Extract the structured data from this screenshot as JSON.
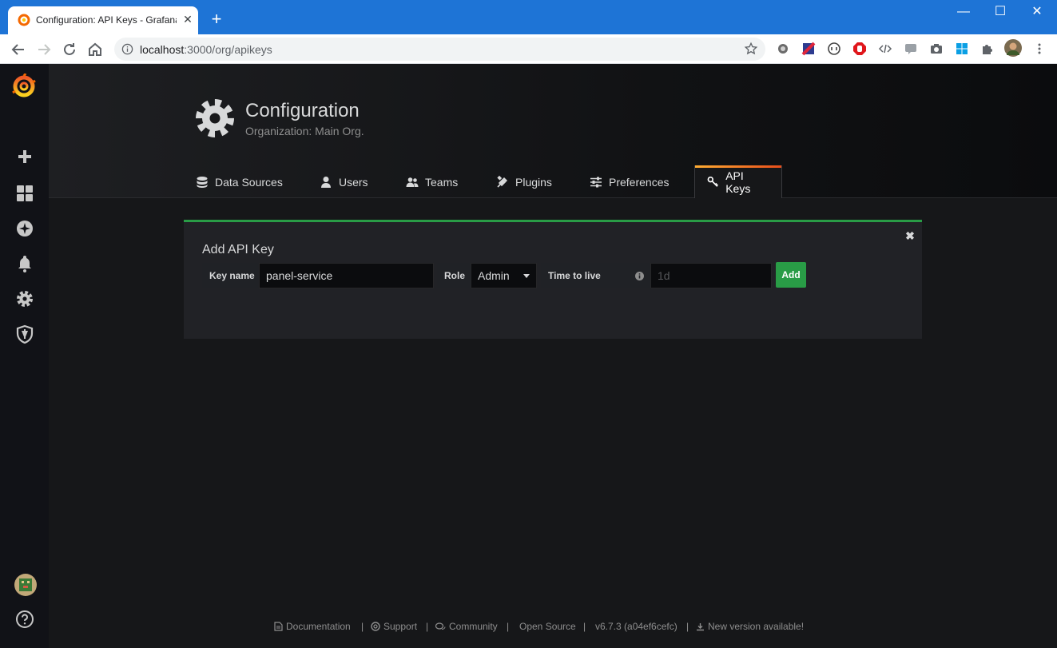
{
  "browser": {
    "tab_title": "Configuration: API Keys - Grafana",
    "url_host": "localhost",
    "url_rest": ":3000/org/apikeys",
    "colors": {
      "titlebar": "#1e74d6",
      "toolbar": "#ffffff"
    }
  },
  "sidebar": {
    "items": [
      {
        "name": "grafana-logo-icon"
      },
      {
        "name": "plus-icon"
      },
      {
        "name": "dashboards-icon"
      },
      {
        "name": "explore-compass-icon"
      },
      {
        "name": "alerting-bell-icon"
      },
      {
        "name": "configuration-gear-icon"
      },
      {
        "name": "server-admin-shield-icon"
      },
      {
        "name": "user-avatar"
      },
      {
        "name": "help-icon"
      }
    ]
  },
  "header": {
    "title": "Configuration",
    "subtitle": "Organization: Main Org."
  },
  "tabs": [
    {
      "label": "Data Sources",
      "icon": "database-icon"
    },
    {
      "label": "Users",
      "icon": "user-icon"
    },
    {
      "label": "Teams",
      "icon": "users-icon"
    },
    {
      "label": "Plugins",
      "icon": "plug-icon"
    },
    {
      "label": "Preferences",
      "icon": "sliders-icon"
    },
    {
      "label": "API Keys",
      "icon": "key-icon",
      "active": true
    }
  ],
  "add_key": {
    "title": "Add API Key",
    "key_name_label": "Key name",
    "key_name_value": "panel-service",
    "role_label": "Role",
    "role_value": "Admin",
    "ttl_label": "Time to live",
    "ttl_placeholder": "1d",
    "add_label": "Add"
  },
  "footer": {
    "documentation": "Documentation",
    "support": "Support",
    "community": "Community",
    "open_source": "Open Source",
    "version": "v6.7.3 (a04ef6cefc)",
    "new_version": "New version available!",
    "separator": "|"
  }
}
